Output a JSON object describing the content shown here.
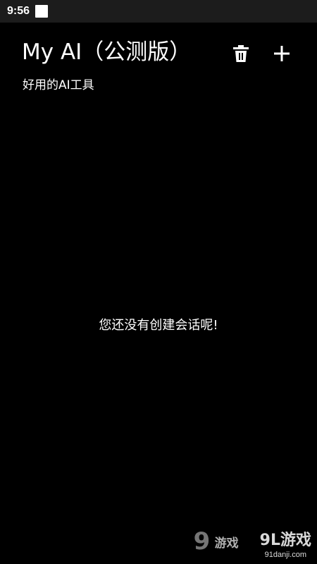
{
  "status_bar": {
    "time": "9:56"
  },
  "header": {
    "title": "My AI（公测版）",
    "subtitle": "好用的AI工具",
    "actions": {
      "delete_icon": "trash-icon",
      "add_icon": "plus-icon"
    }
  },
  "main": {
    "empty_message": "您还没有创建会话呢!"
  },
  "watermark": {
    "left_mark": "9",
    "left_text": "游戏",
    "brand": "9L游戏",
    "domain": "91danji.com"
  },
  "colors": {
    "background": "#000000",
    "status_bar": "#1c1c1c",
    "text": "#ffffff"
  }
}
